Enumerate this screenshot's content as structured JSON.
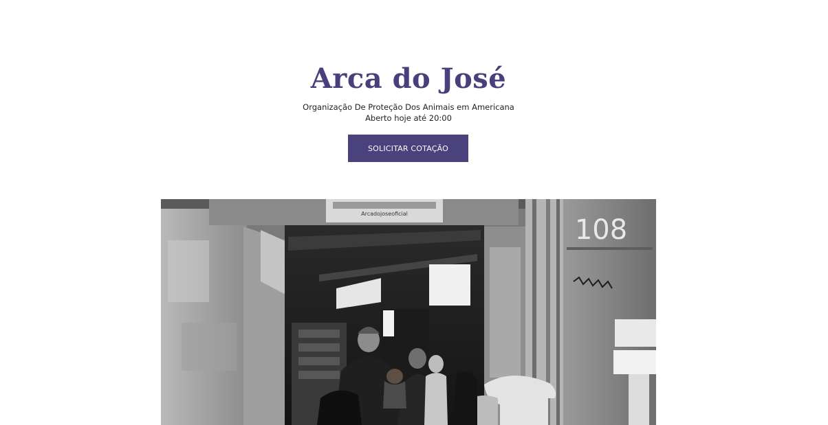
{
  "business": {
    "name": "Arca do José",
    "category_line": "Organização De Proteção Dos Animais em Americana",
    "hours_line": "Aberto hoje até 20:00"
  },
  "actions": {
    "quote_button_label": "SOLICITAR COTAÇÃO"
  },
  "photo": {
    "sign_text": "Arcadojoseoficial",
    "wall_number": "108"
  },
  "colors": {
    "brand": "#483f7b",
    "button_bg": "#4a427d",
    "button_text": "#ffffff"
  }
}
